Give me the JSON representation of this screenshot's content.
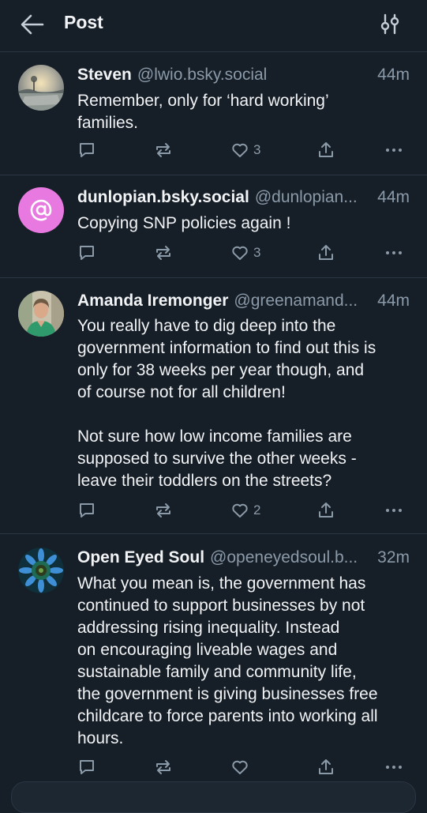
{
  "header": {
    "title": "Post"
  },
  "colors": {
    "background": "#161e27",
    "divider": "#2a3643",
    "text": "#f1f3f5",
    "muted": "#8b9aa9",
    "default_avatar": "#e879e0"
  },
  "posts": [
    {
      "name": "Steven",
      "handle": "@lwio.bsky.social",
      "time": "44m",
      "text": "Remember, only for ‘hard working’\nfamilies.",
      "likes": "3",
      "avatar": "landscape-photo"
    },
    {
      "name": "dunlopian.bsky.social",
      "handle": "@dunlopian...",
      "time": "44m",
      "text": "Copying SNP policies again !",
      "likes": "3",
      "avatar": "at-sign-icon"
    },
    {
      "name": "Amanda Iremonger",
      "handle": "@greenamand...",
      "time": "44m",
      "text": "You really have to dig deep into the\ngovernment information to find out this is\nonly for 38 weeks per year though, and\nof course not for all children!\n\nNot sure how low income families are\nsupposed to survive the other weeks -\nleave their toddlers on the streets?",
      "likes": "2",
      "avatar": "person-photo"
    },
    {
      "name": "Open Eyed Soul",
      "handle": "@openeyedsoul.b...",
      "time": "32m",
      "text": "What you mean is, the government has\ncontinued to support businesses by not\naddressing rising inequality. Instead\non encouraging liveable wages and\nsustainable family and community life,\nthe government is giving businesses free\nchildcare to force parents into working all\nhours.",
      "likes": "",
      "avatar": "sunflower-photo"
    }
  ]
}
